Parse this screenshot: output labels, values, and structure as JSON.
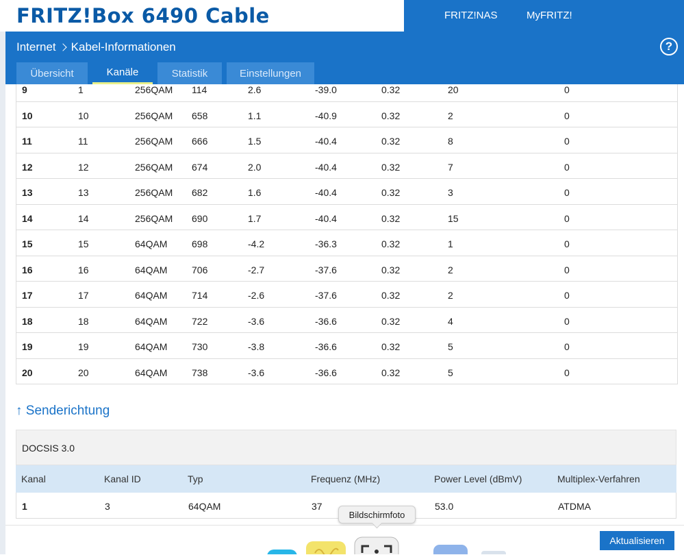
{
  "header": {
    "brand": "FRITZ!Box 6490 Cable",
    "links": [
      "FRITZ!NAS",
      "MyFRITZ!"
    ],
    "breadcrumb": [
      "Internet",
      "Kabel-Informationen"
    ],
    "help_icon": "help-icon",
    "tabs": [
      {
        "label": "Übersicht"
      },
      {
        "label": "Kanäle"
      },
      {
        "label": "Statistik"
      },
      {
        "label": "Einstellungen"
      }
    ],
    "active_tab": "Kanäle"
  },
  "downstream_rows": [
    [
      "9",
      "1",
      "256QAM",
      "114",
      "2.6",
      "-39.0",
      "0.32",
      "20",
      "0"
    ],
    [
      "10",
      "10",
      "256QAM",
      "658",
      "1.1",
      "-40.9",
      "0.32",
      "2",
      "0"
    ],
    [
      "11",
      "11",
      "256QAM",
      "666",
      "1.5",
      "-40.4",
      "0.32",
      "8",
      "0"
    ],
    [
      "12",
      "12",
      "256QAM",
      "674",
      "2.0",
      "-40.4",
      "0.32",
      "7",
      "0"
    ],
    [
      "13",
      "13",
      "256QAM",
      "682",
      "1.6",
      "-40.4",
      "0.32",
      "3",
      "0"
    ],
    [
      "14",
      "14",
      "256QAM",
      "690",
      "1.7",
      "-40.4",
      "0.32",
      "15",
      "0"
    ],
    [
      "15",
      "15",
      "64QAM",
      "698",
      "-4.2",
      "-36.3",
      "0.32",
      "1",
      "0"
    ],
    [
      "16",
      "16",
      "64QAM",
      "706",
      "-2.7",
      "-37.6",
      "0.32",
      "2",
      "0"
    ],
    [
      "17",
      "17",
      "64QAM",
      "714",
      "-2.6",
      "-37.6",
      "0.32",
      "2",
      "0"
    ],
    [
      "18",
      "18",
      "64QAM",
      "722",
      "-3.6",
      "-36.6",
      "0.32",
      "4",
      "0"
    ],
    [
      "19",
      "19",
      "64QAM",
      "730",
      "-3.8",
      "-36.6",
      "0.32",
      "5",
      "0"
    ],
    [
      "20",
      "20",
      "64QAM",
      "738",
      "-3.6",
      "-36.6",
      "0.32",
      "5",
      "0"
    ]
  ],
  "upstream": {
    "title": "↑ Senderichtung",
    "docsis": "DOCSIS 3.0",
    "headers": [
      "Kanal",
      "Kanal ID",
      "Typ",
      "Frequenz (MHz)",
      "Power Level (dBmV)",
      "Multiplex-Verfahren"
    ],
    "rows": [
      [
        "1",
        "3",
        "64QAM",
        "37",
        "53.0",
        "ATDMA"
      ]
    ]
  },
  "footer": {
    "refresh_label": "Aktualisieren",
    "tooltip": "Bildschirmfoto"
  },
  "colors": {
    "brand_blue": "#1a73c8",
    "tab_inactive": "#3a8ad6",
    "active_underline": "#e9f08a",
    "upstream_header_bg": "#d6e7f6"
  }
}
